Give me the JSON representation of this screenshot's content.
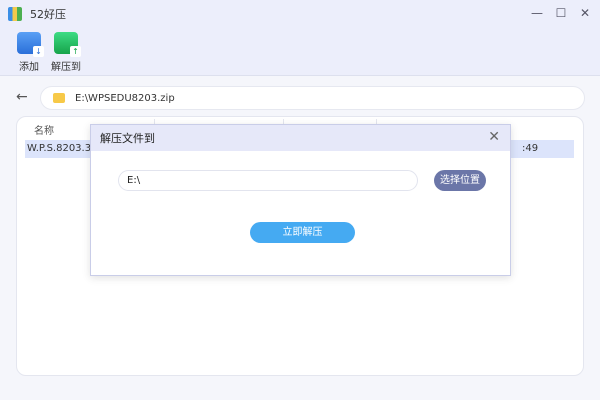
{
  "window": {
    "title": "52好压",
    "minimize": "—",
    "maximize": "☐",
    "close": "✕"
  },
  "toolbar": {
    "add_label": "添加",
    "extract_label": "解压到"
  },
  "pathbar": {
    "back": "←",
    "path": "E:\\WPSEDU8203.zip"
  },
  "table": {
    "columns": [
      "名称",
      "",
      "",
      ""
    ],
    "rows": [
      {
        "name": "W.P.S.8203.30.",
        "tail": ":49"
      }
    ]
  },
  "dialog": {
    "title": "解压文件到",
    "close": "✕",
    "path_value": "E:\\",
    "choose_label": "选择位置",
    "extract_now_label": "立即解压"
  },
  "colors": {
    "accent": "#45aaf2",
    "choose_button": "#6b76a8",
    "selected_row": "#dce4fb"
  }
}
